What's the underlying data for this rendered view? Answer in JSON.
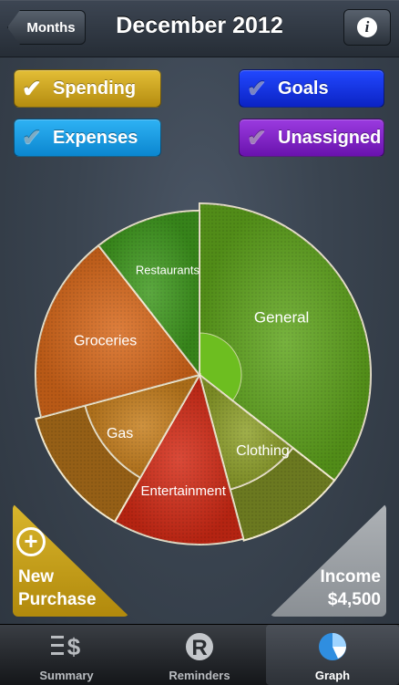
{
  "nav": {
    "back_label": "Months",
    "title": "December 2012",
    "info_icon": "info-icon"
  },
  "filters": {
    "spending": {
      "label": "Spending",
      "checked": true,
      "color": "#c9a21d"
    },
    "goals": {
      "label": "Goals",
      "checked": false,
      "color": "#1433e6"
    },
    "expenses": {
      "label": "Expenses",
      "checked": false,
      "color": "#1c9ce2"
    },
    "unassigned": {
      "label": "Unassigned",
      "checked": false,
      "color": "#8426c7"
    }
  },
  "chart_data": {
    "type": "pie",
    "segments": [
      {
        "label": "General",
        "color": "#5fa51c"
      },
      {
        "label": "Clothing",
        "color": "#8fa12a"
      },
      {
        "label": "Entertainment",
        "color": "#d42a15"
      },
      {
        "label": "Gas",
        "color": "#c77f1d"
      },
      {
        "label": "Groceries",
        "color": "#d8681a"
      },
      {
        "label": "Restaurants",
        "color": "#3f9a1e"
      }
    ]
  },
  "actions": {
    "new_purchase_line1": "New",
    "new_purchase_line2": "Purchase",
    "income_label": "Income",
    "income_value": "$4,500"
  },
  "tabs": [
    {
      "label": "Summary",
      "icon": "summary-icon",
      "selected": false
    },
    {
      "label": "Reminders",
      "icon": "reminders-icon",
      "selected": false
    },
    {
      "label": "Graph",
      "icon": "graph-icon",
      "selected": true
    }
  ]
}
